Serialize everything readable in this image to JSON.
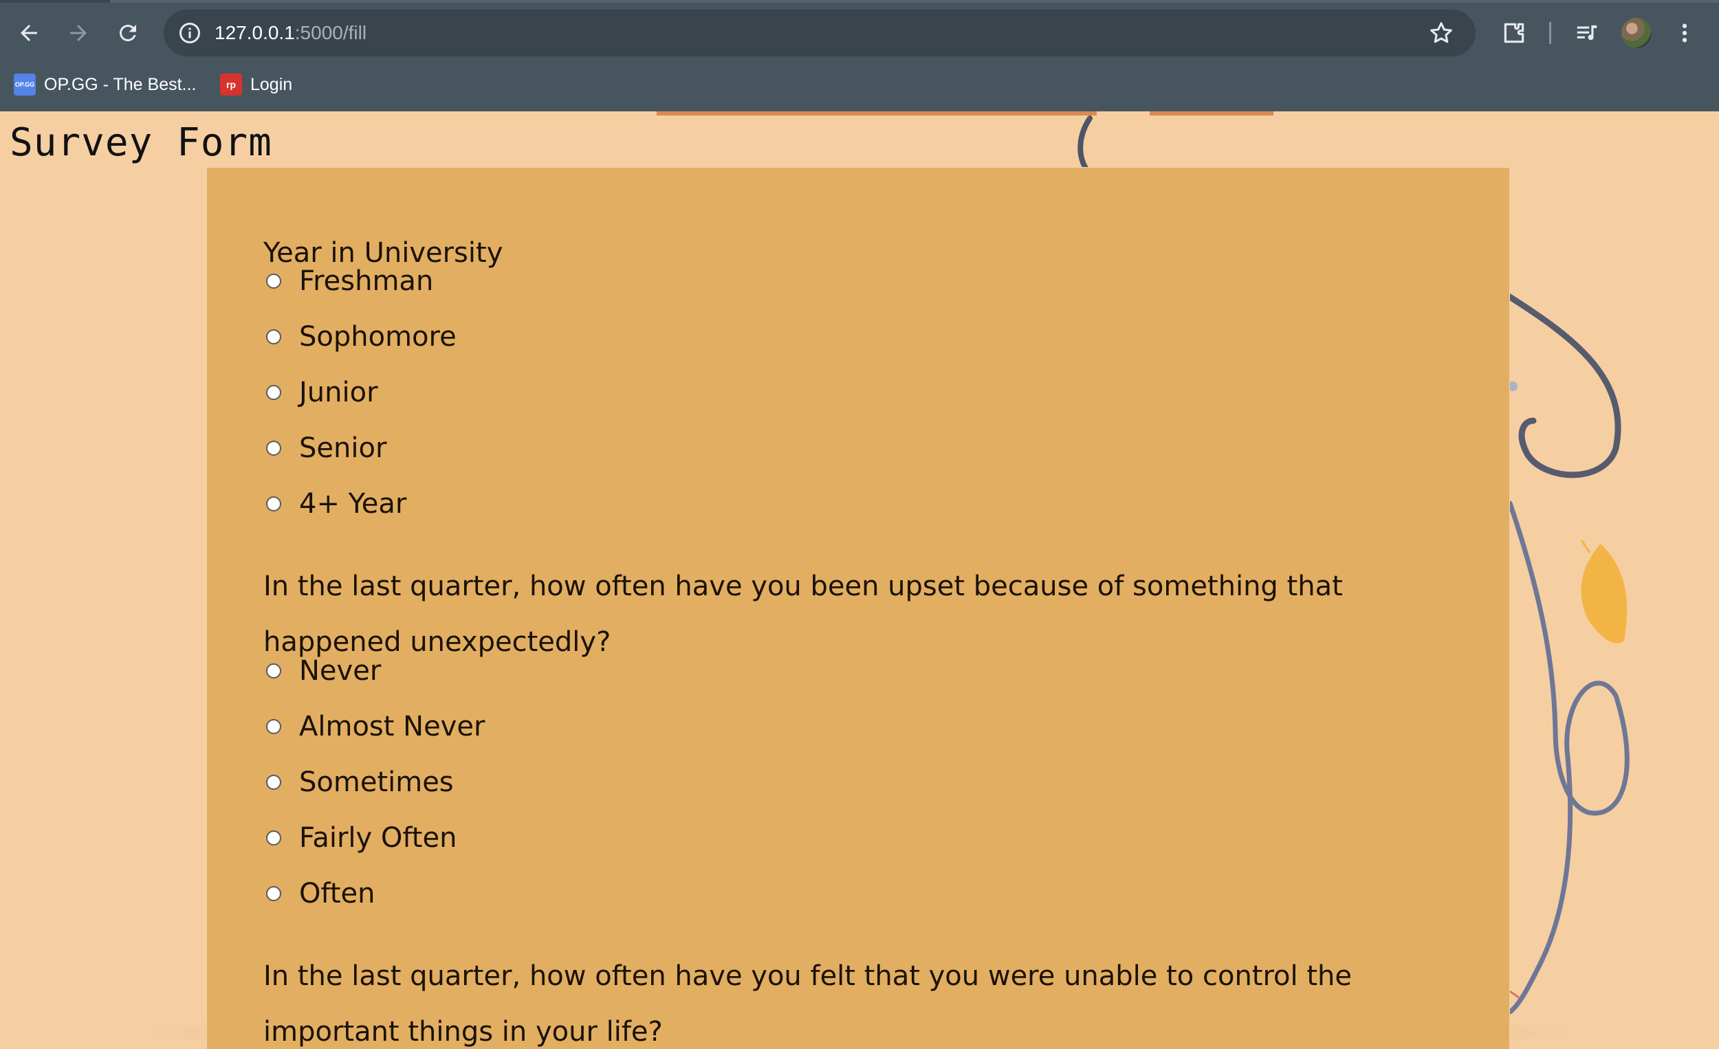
{
  "browser": {
    "url_host": "127.0.0.1",
    "url_path": ":5000/fill",
    "bookmarks": [
      {
        "label": "OP.GG - The Best...",
        "favicon": "opgg-favicon",
        "color": "#5383e8"
      },
      {
        "label": "Login",
        "favicon": "rp-favicon",
        "color": "#d8322f"
      }
    ],
    "icons": [
      "back-arrow-icon",
      "forward-arrow-icon",
      "reload-icon",
      "info-icon",
      "star-icon",
      "extensions-icon",
      "media-control-icon",
      "avatar",
      "more-vert-icon"
    ]
  },
  "page": {
    "title": "Survey Form",
    "background_color": "#f5cfa2",
    "card_color": "#e2ae62"
  },
  "survey": {
    "q1": {
      "label": "Year in University",
      "options": [
        "Freshman",
        "Sophomore",
        "Junior",
        "Senior",
        "4+ Year"
      ]
    },
    "q2": {
      "label": "In the last quarter, how often have you been upset because of something that happened unexpectedly?",
      "options": [
        "Never",
        "Almost Never",
        "Sometimes",
        "Fairly Often",
        "Often"
      ]
    },
    "q3": {
      "label": "In the last quarter, how often have you felt that you were unable to control the important things in your life?"
    }
  }
}
